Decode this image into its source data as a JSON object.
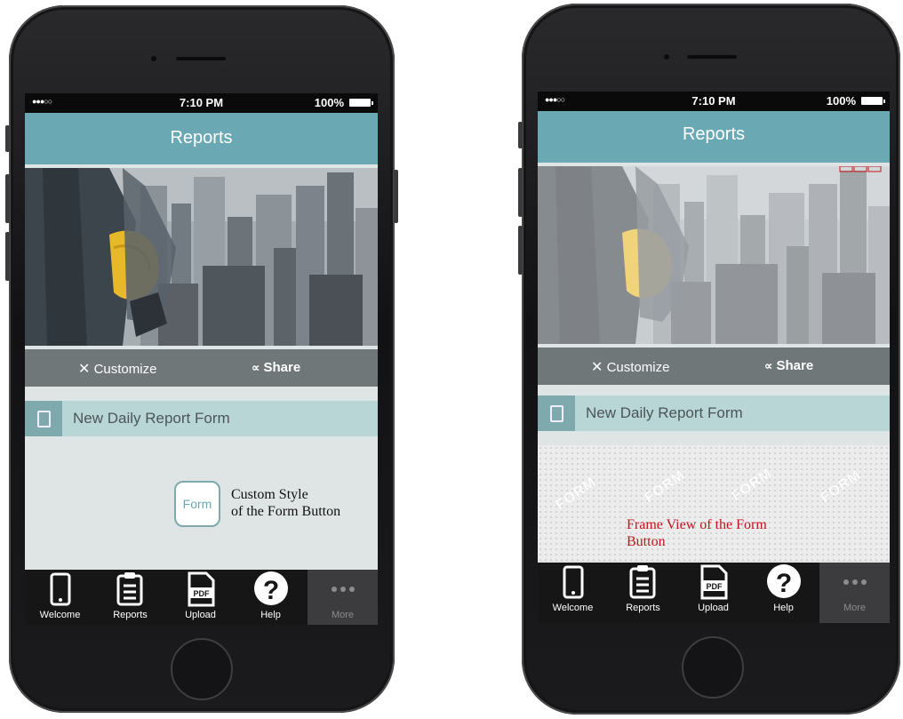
{
  "status": {
    "dots": "●●●○○",
    "time": "7:10 PM",
    "battery": "100%"
  },
  "header": {
    "title": "Reports"
  },
  "actions": {
    "customize": "Customize",
    "share": "Share"
  },
  "form_row": {
    "label": "New Daily Report Form"
  },
  "form_button": {
    "label": "Form"
  },
  "annotations": {
    "left": [
      "Custom Style",
      "of the Form Button"
    ],
    "right": [
      "Frame View of the Form",
      "Button"
    ]
  },
  "watermark_text": "FORM",
  "tabs": [
    "Welcome",
    "Reports",
    "Upload",
    "Help",
    "More"
  ],
  "icons": {
    "customize": "wrench-cross-icon",
    "share": "share-icon",
    "form": "form-document-icon",
    "welcome": "phone-icon",
    "reports": "clipboard-icon",
    "upload": "pdf-icon",
    "help": "question-icon",
    "more": "more-dots-icon"
  },
  "colors": {
    "accent": "#6aa9b4",
    "action_bar": "#6f7779",
    "form_row": "#b9d6d7",
    "annotation_red": "#c0151d",
    "tab_bar": "#161616"
  }
}
